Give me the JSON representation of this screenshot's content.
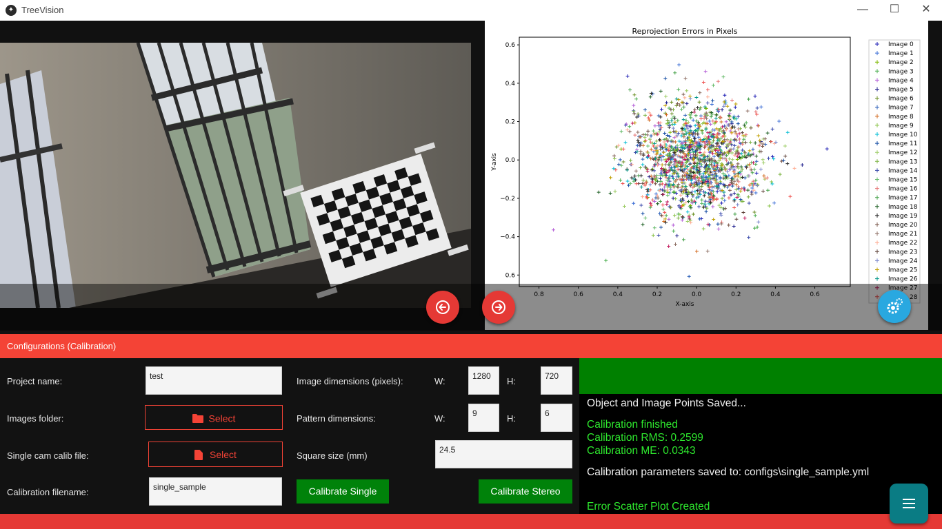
{
  "window": {
    "title": "TreeVision",
    "minimize_symbol": "—",
    "maximize_symbol": "☐",
    "close_symbol": "✕"
  },
  "chart_data": {
    "type": "scatter",
    "title": "Reprojection Errors in Pixels",
    "xlabel": "X-axis",
    "ylabel": "Y-axis",
    "xlim": [
      -0.9,
      0.78
    ],
    "ylim": [
      -0.66,
      0.64
    ],
    "xticks": [
      "0.8",
      "0.6",
      "0.4",
      "0.2",
      "0.0",
      "0.2",
      "0.4",
      "0.6"
    ],
    "yticks": [
      "0.6",
      "0.4",
      "0.2",
      "0.0",
      "−0.2",
      "−0.4",
      "0.6"
    ],
    "marker": "+",
    "legend_placement": "right",
    "series": [
      {
        "name": "Image 0",
        "color": "#1f1fb4"
      },
      {
        "name": "Image 1",
        "color": "#3d6fd6"
      },
      {
        "name": "Image 2",
        "color": "#7fb800"
      },
      {
        "name": "Image 3",
        "color": "#4caf50"
      },
      {
        "name": "Image 4",
        "color": "#b560d8"
      },
      {
        "name": "Image 5",
        "color": "#1a1a8a"
      },
      {
        "name": "Image 6",
        "color": "#6b8e23"
      },
      {
        "name": "Image 7",
        "color": "#2b5fb8"
      },
      {
        "name": "Image 8",
        "color": "#d2691e"
      },
      {
        "name": "Image 9",
        "color": "#8bc34a"
      },
      {
        "name": "Image 10",
        "color": "#00bcd4"
      },
      {
        "name": "Image 11",
        "color": "#0d47a1"
      },
      {
        "name": "Image 12",
        "color": "#9ccc65"
      },
      {
        "name": "Image 13",
        "color": "#7cb342"
      },
      {
        "name": "Image 14",
        "color": "#3949ab"
      },
      {
        "name": "Image 15",
        "color": "#66bb6a"
      },
      {
        "name": "Image 16",
        "color": "#e57373"
      },
      {
        "name": "Image 17",
        "color": "#43a047"
      },
      {
        "name": "Image 18",
        "color": "#1b5e20"
      },
      {
        "name": "Image 19",
        "color": "#212121"
      },
      {
        "name": "Image 20",
        "color": "#795548"
      },
      {
        "name": "Image 21",
        "color": "#8d6e63"
      },
      {
        "name": "Image 22",
        "color": "#ffab91"
      },
      {
        "name": "Image 23",
        "color": "#5d4037"
      },
      {
        "name": "Image 24",
        "color": "#7986cb"
      },
      {
        "name": "Image 25",
        "color": "#c0a000"
      },
      {
        "name": "Image 26",
        "color": "#009688"
      },
      {
        "name": "Image 27",
        "color": "#c2185b"
      },
      {
        "name": "Image 28",
        "color": "#ef5350"
      }
    ],
    "points_per_series": 55
  },
  "config": {
    "header": "Configurations (Calibration)",
    "project_name_label": "Project name:",
    "project_name_value": "test",
    "images_folder_label": "Images folder:",
    "images_folder_button": "Select",
    "single_cam_label": "Single cam calib file:",
    "single_cam_button": "Select",
    "calib_filename_label": "Calibration filename:",
    "calib_filename_value": "single_sample",
    "image_dims_label": "Image dimensions (pixels):",
    "image_w_label": "W:",
    "image_w_value": "1280",
    "image_h_label": "H:",
    "image_h_value": "720",
    "pattern_dims_label": "Pattern dimensions:",
    "pattern_w_label": "W:",
    "pattern_w_value": "9",
    "pattern_h_label": "H:",
    "pattern_h_value": "6",
    "square_size_label": "Square size (mm)",
    "square_size_value": "24.5",
    "calibrate_single": "Calibrate Single",
    "calibrate_stereo": "Calibrate Stereo"
  },
  "log": {
    "line1": "Object and Image Points Saved...",
    "line2": "Calibration finished",
    "line3": "Calibration RMS: 0.2599",
    "line4": "Calibration ME: 0.0343",
    "line5": "Calibration parameters saved to: configs\\single_sample.yml",
    "line6": "Error Scatter Plot Created",
    "colors": {
      "white": "#f0f0f0",
      "green": "#2ee82e"
    }
  },
  "icons": {
    "prev": "arrow-left-circle-icon",
    "next": "arrow-right-circle-icon",
    "settings": "gears-icon",
    "menu": "hamburger-menu-icon",
    "folder": "folder-icon",
    "file": "file-icon"
  }
}
